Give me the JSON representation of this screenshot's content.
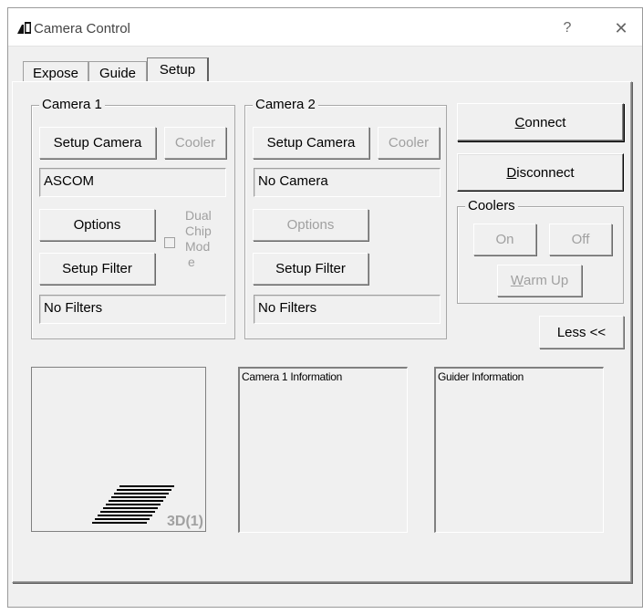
{
  "window": {
    "title": "Camera Control",
    "help": "?",
    "close": "✕"
  },
  "tabs": [
    {
      "label": "Expose"
    },
    {
      "label": "Guide"
    },
    {
      "label": "Setup",
      "active": true
    }
  ],
  "camera1": {
    "group_label": "Camera 1",
    "setup_camera": "Setup Camera",
    "cooler": "Cooler",
    "camera_value": "ASCOM",
    "options": "Options",
    "dual_chip_mode": [
      "Dual",
      "Chip",
      "Mod",
      "e"
    ],
    "setup_filter": "Setup Filter",
    "filter_value": "No Filters"
  },
  "camera2": {
    "group_label": "Camera 2",
    "setup_camera": "Setup Camera",
    "cooler": "Cooler",
    "camera_value": "No Camera",
    "options": "Options",
    "setup_filter": "Setup Filter",
    "filter_value": "No Filters"
  },
  "connection": {
    "connect_prefix": "C",
    "connect_rest": "onnect",
    "disconnect_prefix": "D",
    "disconnect_rest": "isconnect"
  },
  "coolers": {
    "group_label": "Coolers",
    "on": "On",
    "off": "Off",
    "warm_up_prefix": "W",
    "warm_up_rest": "arm Up"
  },
  "less_button": "Less <<",
  "preview": {
    "label": "3D(1)"
  },
  "info": {
    "camera1": "Camera 1 Information",
    "guider": "Guider Information"
  },
  "colors": {
    "background": "#f0f0f0",
    "disabled_text": "#a0a0a0",
    "border_dark": "#808080"
  }
}
